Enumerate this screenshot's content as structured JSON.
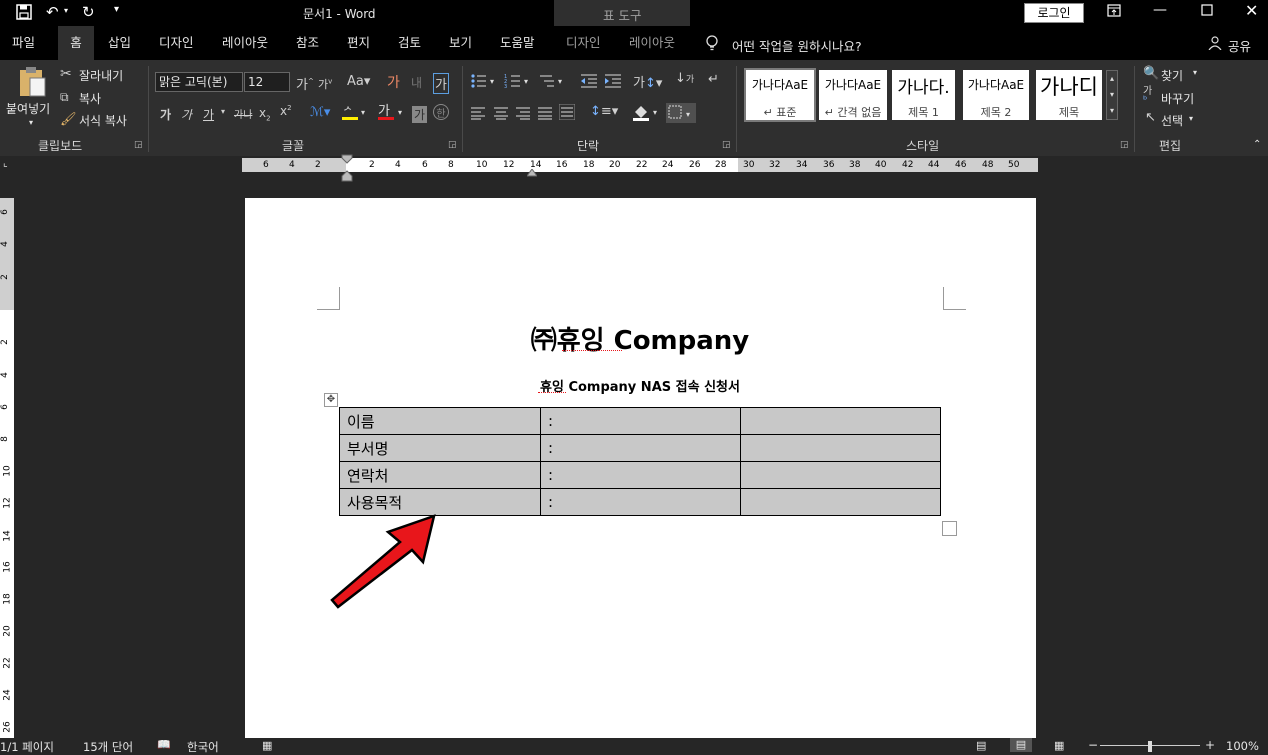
{
  "title_bar": {
    "doc_title": "문서1",
    "app_name": "Word",
    "table_tools": "표 도구",
    "login": "로그인"
  },
  "tabs": [
    "파일",
    "홈",
    "삽입",
    "디자인",
    "레이아웃",
    "참조",
    "편지",
    "검토",
    "보기",
    "도움말"
  ],
  "context_tabs": [
    "디자인",
    "레이아웃"
  ],
  "tell_me": "어떤 작업을 원하시나요?",
  "share": "공유",
  "clipboard": {
    "paste": "붙여넣기",
    "cut": "잘라내기",
    "copy": "복사",
    "format_painter": "서식 복사",
    "group": "클립보드"
  },
  "font": {
    "name": "맑은 고딕(본)",
    "size": "12",
    "group": "글꼴"
  },
  "paragraph": {
    "group": "단락"
  },
  "styles": {
    "group": "스타일",
    "items": [
      {
        "sample": "가나다AaE",
        "label": "↵ 표준"
      },
      {
        "sample": "가나다AaE",
        "label": "↵ 간격 없음"
      },
      {
        "sample": "가나다.",
        "label": "제목 1"
      },
      {
        "sample": "가나다AaE",
        "label": "제목 2"
      },
      {
        "sample": "가나디",
        "label": "제목"
      }
    ]
  },
  "editing": {
    "find": "찾기",
    "replace": "바꾸기",
    "select": "선택",
    "group": "편집"
  },
  "ruler": {
    "h_labels": [
      "6",
      "4",
      "2",
      "2",
      "4",
      "6",
      "8",
      "10",
      "12",
      "14",
      "16",
      "18",
      "20",
      "22",
      "24",
      "26",
      "28",
      "30",
      "32",
      "34",
      "36",
      "38",
      "40",
      "42",
      "44",
      "46",
      "48",
      "50"
    ],
    "v_labels": [
      "6",
      "4",
      "2",
      "2",
      "4",
      "6",
      "8",
      "10",
      "12",
      "14",
      "16",
      "18",
      "20",
      "22",
      "24",
      "26"
    ]
  },
  "document": {
    "title": "㈜휴잉  Company",
    "subtitle": "휴잉  Company  NAS  접속  신청서",
    "table": [
      [
        "이름",
        ":",
        ""
      ],
      [
        "부서명",
        ":",
        ""
      ],
      [
        "연락처",
        ":",
        ""
      ],
      [
        "사용목적",
        ":",
        ""
      ]
    ]
  },
  "status_bar": {
    "page": "1/1 페이지",
    "words": "15개 단어",
    "language": "한국어",
    "zoom": "100%"
  },
  "colors": {
    "dark_bg": "#262626",
    "ribbon": "#2f2f2f",
    "cell_gray": "#c8c8c8",
    "arrow_red": "#e8161b"
  }
}
